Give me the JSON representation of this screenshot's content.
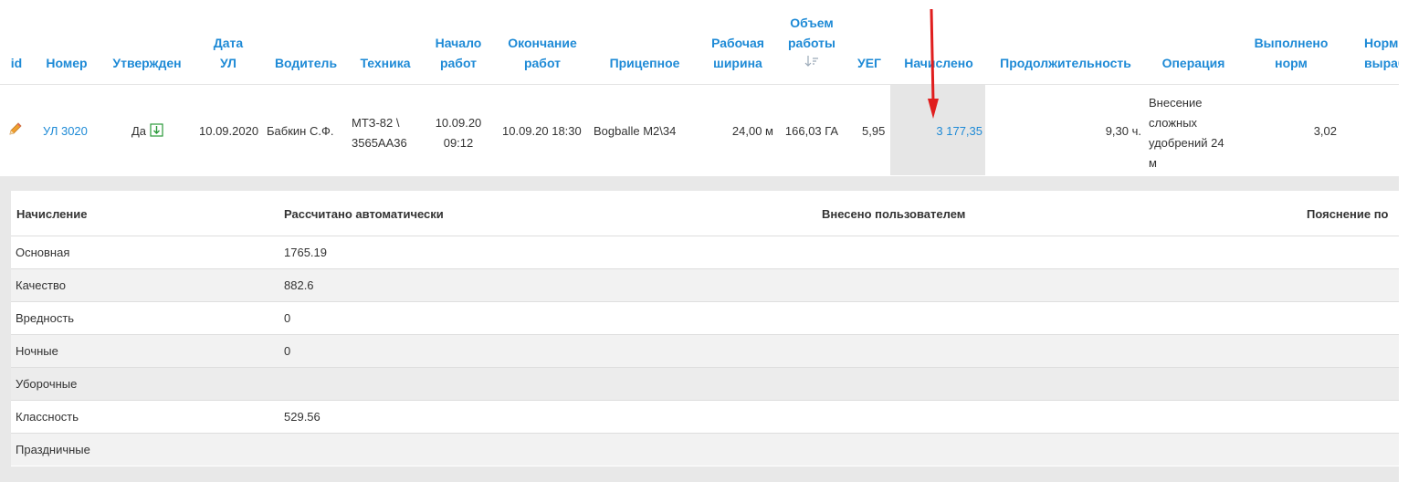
{
  "columns": {
    "id": "id",
    "number": "Номер",
    "approved": "Утвержден",
    "date_l1": "Дата",
    "date_l2": "УЛ",
    "driver": "Водитель",
    "equipment": "Техника",
    "start_l1": "Начало",
    "start_l2": "работ",
    "end_l1": "Окончание",
    "end_l2": "работ",
    "trailer": "Прицепное",
    "width_l1": "Рабочая",
    "width_l2": "ширина",
    "volume_l1": "Объем",
    "volume_l2": "работы",
    "volume_sort_icon": "sort-down-icon",
    "ueg": "УЕГ",
    "accrued": "Начислено",
    "duration": "Продолжительность",
    "operation": "Операция",
    "done_l1": "Выполнено",
    "done_l2": "норм",
    "norm_l1": "Норм",
    "norm_l2": "вырабо"
  },
  "row": {
    "edit_icon": "pencil-icon",
    "number": "УЛ 3020",
    "approved": "Да",
    "approved_icon": "download-icon",
    "date": "10.09.2020",
    "driver": "Бабкин С.Ф.",
    "equipment_l1": "МТЗ-82 \\",
    "equipment_l2": "3565АА36",
    "start_l1": "10.09.20",
    "start_l2": "09:12",
    "end": "10.09.20 18:30",
    "trailer": "Bogballe M2\\34",
    "width": "24,00 м",
    "volume": "166,03 ГА",
    "ueg": "5,95",
    "accrued": "3 177,35",
    "duration": "9,30 ч.",
    "operation_l1": "Внесение",
    "operation_l2": "сложных",
    "operation_l3": "удобрений 24",
    "operation_l4": "м",
    "done": "3,02"
  },
  "detail": {
    "headers": {
      "accrual": "Начисление",
      "auto": "Рассчитано автоматически",
      "user": "Внесено пользователем",
      "note": "Пояснение по"
    },
    "rows": [
      {
        "name": "Основная",
        "auto": "1765.19"
      },
      {
        "name": "Качество",
        "auto": "882.6"
      },
      {
        "name": "Вредность",
        "auto": "0"
      },
      {
        "name": "Ночные",
        "auto": "0"
      },
      {
        "name": "Уборочные",
        "auto": ""
      },
      {
        "name": "Классность",
        "auto": "529.56"
      },
      {
        "name": "Праздничные",
        "auto": ""
      }
    ]
  },
  "colors": {
    "accent": "#1e8ad6",
    "arrow": "#e01e1e",
    "highlight_cell": "#e6e6e6"
  }
}
